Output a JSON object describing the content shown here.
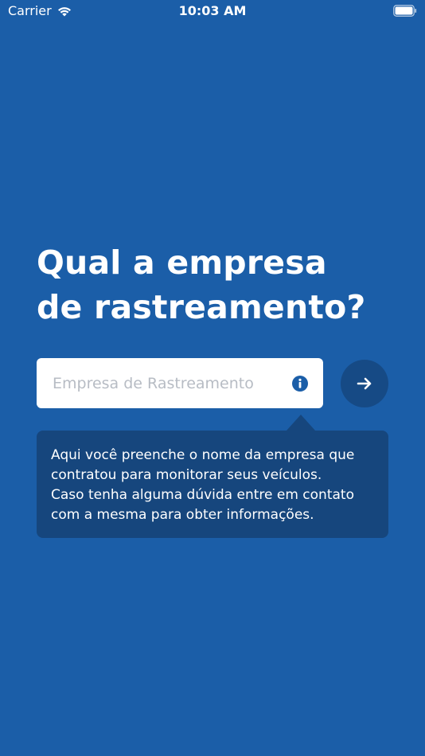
{
  "status_bar": {
    "carrier": "Carrier",
    "time": "10:03 AM",
    "wifi_icon": "wifi-icon",
    "battery_icon": "battery-icon"
  },
  "title": {
    "line1": "Qual a empresa",
    "line2": "de rastreamento?"
  },
  "company_input": {
    "placeholder": "Empresa de Rastreamento",
    "value": "",
    "info_icon": "info-icon"
  },
  "next_button": {
    "icon": "arrow-right-icon"
  },
  "tooltip": {
    "lines": [
      "Aqui você preenche o nome da empresa que",
      "contratou para monitorar seus veículos.",
      "Caso tenha alguma dúvida entre em contato",
      "com a mesma para obter informações."
    ]
  },
  "colors": {
    "background": "#1b5ea8",
    "dark_accent": "#16467d",
    "button": "#164a85",
    "input_background": "#ffffff",
    "placeholder": "#b7bcc4"
  }
}
